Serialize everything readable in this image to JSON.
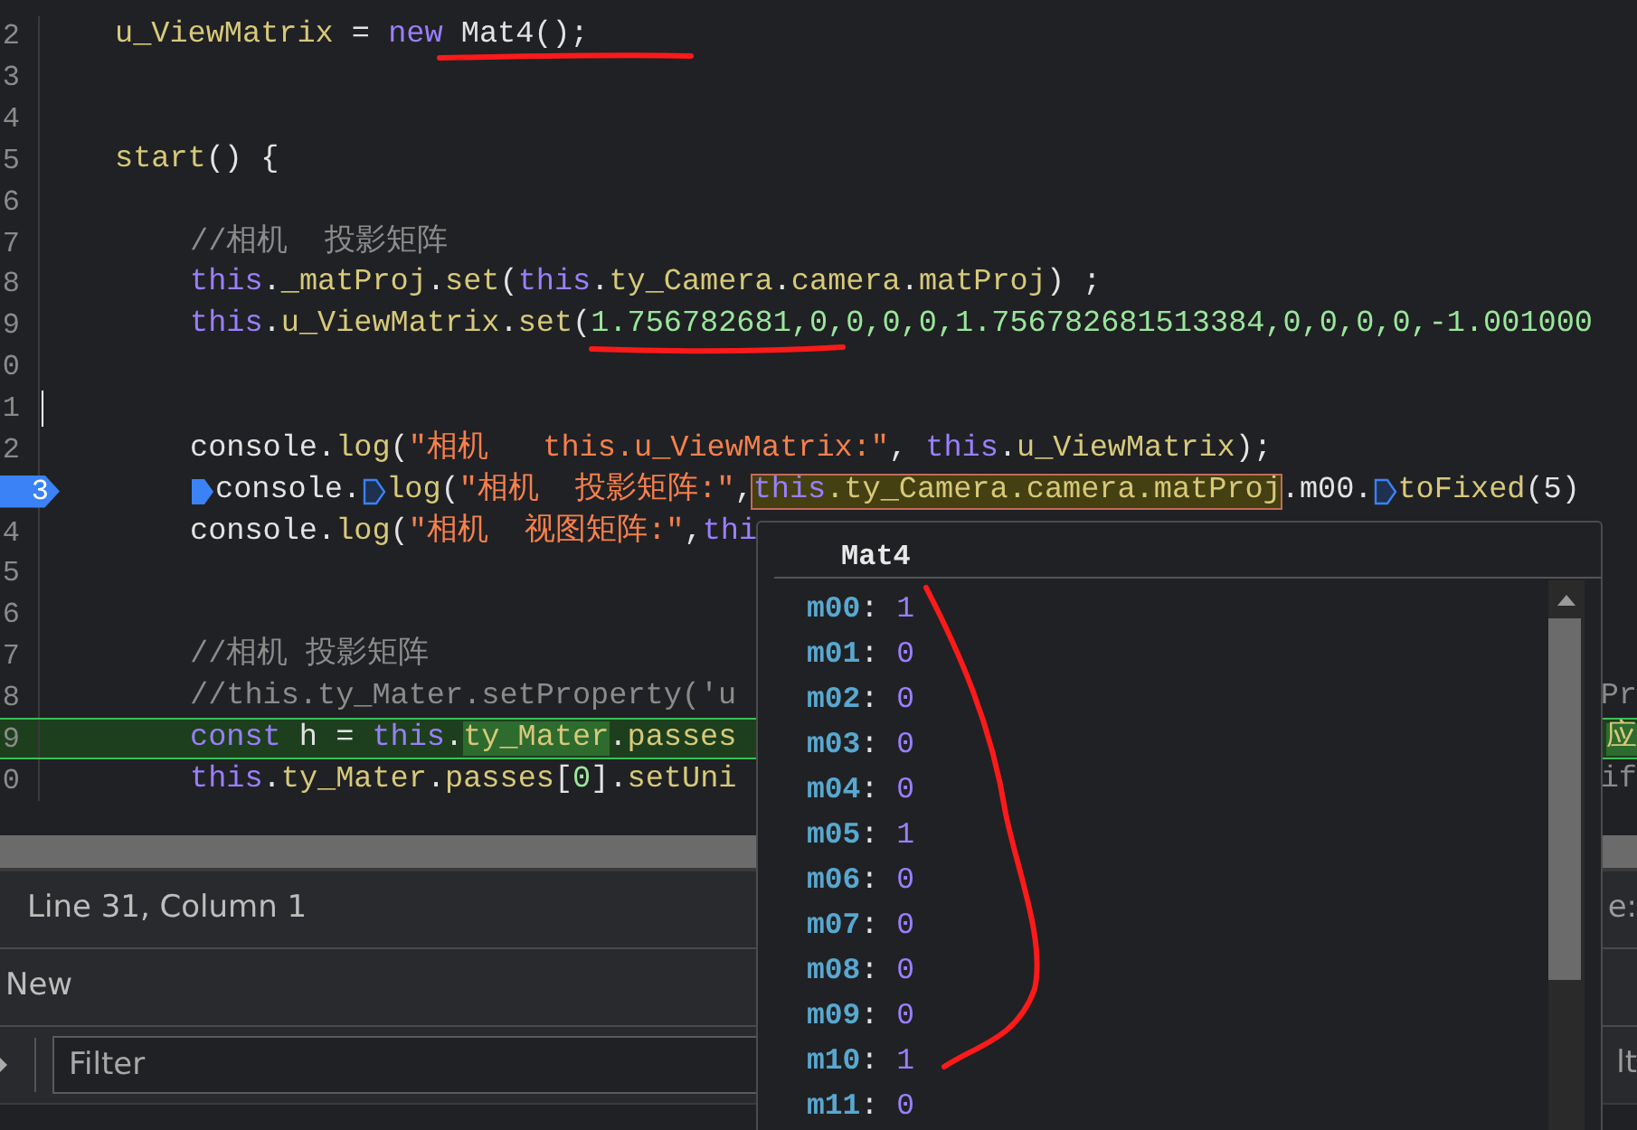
{
  "editor": {
    "lines": [
      {
        "number": "2",
        "paused": false,
        "highlighted": false,
        "cursor": false,
        "tokens": [
          {
            "kind": "ident",
            "text": "u_ViewMatrix"
          },
          {
            "kind": "plain",
            "text": " = "
          },
          {
            "kind": "keyword",
            "text": "new"
          },
          {
            "kind": "plain",
            "text": " Mat4();"
          }
        ]
      },
      {
        "number": "3",
        "paused": false,
        "highlighted": false,
        "cursor": false
      },
      {
        "number": "4",
        "paused": false,
        "highlighted": false,
        "cursor": false
      },
      {
        "number": "5",
        "paused": false,
        "highlighted": false,
        "cursor": false,
        "tokens": [
          {
            "kind": "ident",
            "text": "start"
          },
          {
            "kind": "plain",
            "text": "() {"
          }
        ],
        "children": [
          {
            "number": "6",
            "paused": false,
            "highlighted": false,
            "cursor": false
          },
          {
            "number": "7",
            "paused": false,
            "highlighted": false,
            "cursor": false,
            "tokens": [
              {
                "kind": "comment",
                "text": "//相机  投影矩阵"
              }
            ]
          },
          {
            "number": "8",
            "paused": false,
            "highlighted": false,
            "cursor": false,
            "tokens": [
              {
                "kind": "keyword",
                "text": "this"
              },
              {
                "kind": "plain",
                "text": "."
              },
              {
                "kind": "ident",
                "text": "_matProj"
              },
              {
                "kind": "plain",
                "text": "."
              },
              {
                "kind": "ident",
                "text": "set"
              },
              {
                "kind": "plain",
                "text": "("
              },
              {
                "kind": "keyword",
                "text": "this"
              },
              {
                "kind": "plain",
                "text": "."
              },
              {
                "kind": "ident",
                "text": "ty_Camera"
              },
              {
                "kind": "plain",
                "text": "."
              },
              {
                "kind": "ident",
                "text": "camera"
              },
              {
                "kind": "plain",
                "text": "."
              },
              {
                "kind": "ident",
                "text": "matProj"
              },
              {
                "kind": "plain",
                "text": ") ;"
              }
            ]
          },
          {
            "number": "9",
            "paused": false,
            "highlighted": false,
            "cursor": false,
            "tokens": [
              {
                "kind": "keyword",
                "text": "this"
              },
              {
                "kind": "plain",
                "text": "."
              },
              {
                "kind": "ident",
                "text": "u_ViewMatrix"
              },
              {
                "kind": "plain",
                "text": "."
              },
              {
                "kind": "ident",
                "text": "set"
              },
              {
                "kind": "plain",
                "text": "("
              },
              {
                "kind": "number",
                "text": "1.756782681,0,0,0,0,1.756782681513384,0,0,0,0,-1.001000"
              }
            ]
          },
          {
            "number": "0",
            "paused": false,
            "highlighted": false,
            "cursor": false
          },
          {
            "number": "1",
            "paused": false,
            "highlighted": false,
            "cursor": true
          },
          {
            "number": "2",
            "paused": false,
            "highlighted": false,
            "cursor": false,
            "tokens": [
              {
                "kind": "plain",
                "text": "console."
              },
              {
                "kind": "ident",
                "text": "log"
              },
              {
                "kind": "plain",
                "text": "("
              },
              {
                "kind": "string",
                "text": "\"相机   this.u_ViewMatrix:\""
              },
              {
                "kind": "plain",
                "text": ", "
              },
              {
                "kind": "keyword",
                "text": "this"
              },
              {
                "kind": "plain",
                "text": "."
              },
              {
                "kind": "ident",
                "text": "u_ViewMatrix"
              },
              {
                "kind": "plain",
                "text": ");"
              }
            ]
          },
          {
            "number": "3",
            "paused": true,
            "highlighted": false,
            "cursor": false,
            "tokens": [
              {
                "kind": "marker"
              },
              {
                "kind": "plain",
                "text": "console."
              },
              {
                "kind": "marker"
              },
              {
                "kind": "ident",
                "text": "log"
              },
              {
                "kind": "plain",
                "text": "("
              },
              {
                "kind": "string",
                "text": "\"相机  投影矩阵:\""
              },
              {
                "kind": "plain",
                "text": ","
              },
              {
                "kind": "boxed",
                "text": "this.ty_Camera.camera.matProj"
              },
              {
                "kind": "plain",
                "text": ".m00."
              },
              {
                "kind": "marker"
              },
              {
                "kind": "ident",
                "text": "toFixed"
              },
              {
                "kind": "plain",
                "text": "(5)"
              }
            ]
          },
          {
            "number": "4",
            "paused": false,
            "highlighted": false,
            "cursor": false,
            "tokens": [
              {
                "kind": "plain",
                "text": "console."
              },
              {
                "kind": "ident",
                "text": "log"
              },
              {
                "kind": "plain",
                "text": "("
              },
              {
                "kind": "string",
                "text": "\"相机  视图矩阵:\""
              },
              {
                "kind": "plain",
                "text": ","
              },
              {
                "kind": "keyword",
                "text": "thi"
              }
            ]
          },
          {
            "number": "5",
            "paused": false,
            "highlighted": false,
            "cursor": false
          },
          {
            "number": "6",
            "paused": false,
            "highlighted": false,
            "cursor": false
          },
          {
            "number": "7",
            "paused": false,
            "highlighted": false,
            "cursor": false,
            "tokens": [
              {
                "kind": "comment",
                "text": "//相机 投影矩阵"
              }
            ]
          },
          {
            "number": "8",
            "paused": false,
            "highlighted": false,
            "cursor": false,
            "tokens": [
              {
                "kind": "comment",
                "text": "//this.ty_Mater.setProperty('u"
              }
            ],
            "right_text": "Pr"
          },
          {
            "number": "9",
            "paused": false,
            "highlighted": true,
            "cursor": false,
            "tokens": [
              {
                "kind": "keyword",
                "text": "const"
              },
              {
                "kind": "plain",
                "text": " h = "
              },
              {
                "kind": "keyword",
                "text": "this"
              },
              {
                "kind": "plain",
                "text": "."
              },
              {
                "kind": "match",
                "text": "ty_Mater"
              },
              {
                "kind": "plain",
                "text": "."
              },
              {
                "kind": "ident",
                "text": "passes"
              }
            ],
            "right_text": "应"
          },
          {
            "number": "0",
            "paused": false,
            "highlighted": false,
            "cursor": false,
            "tokens": [
              {
                "kind": "keyword",
                "text": "this"
              },
              {
                "kind": "plain",
                "text": "."
              },
              {
                "kind": "ident",
                "text": "ty_Mater"
              },
              {
                "kind": "plain",
                "text": "."
              },
              {
                "kind": "ident",
                "text": "passes"
              },
              {
                "kind": "plain",
                "text": "["
              },
              {
                "kind": "number",
                "text": "0"
              },
              {
                "kind": "plain",
                "text": "]."
              },
              {
                "kind": "ident",
                "text": "setUni"
              }
            ],
            "right_text": "if"
          }
        ]
      }
    ]
  },
  "status_bar": {
    "text": "Line 31, Column 1",
    "right_text": "e:"
  },
  "new_row": {
    "text": "New"
  },
  "filter": {
    "placeholder": "Filter",
    "right_text": "lt"
  },
  "popover": {
    "title": "Mat4",
    "entries": [
      {
        "key": "m00:",
        "value": "1"
      },
      {
        "key": "m01:",
        "value": "0"
      },
      {
        "key": "m02:",
        "value": "0"
      },
      {
        "key": "m03:",
        "value": "0"
      },
      {
        "key": "m04:",
        "value": "0"
      },
      {
        "key": "m05:",
        "value": "1"
      },
      {
        "key": "m06:",
        "value": "0"
      },
      {
        "key": "m07:",
        "value": "0"
      },
      {
        "key": "m08:",
        "value": "0"
      },
      {
        "key": "m09:",
        "value": "0"
      },
      {
        "key": "m10:",
        "value": "1"
      },
      {
        "key": "m11:",
        "value": "0"
      }
    ]
  },
  "annotations": [
    {
      "kind": "underline-mat4"
    },
    {
      "kind": "underline-number"
    },
    {
      "kind": "curve"
    }
  ]
}
